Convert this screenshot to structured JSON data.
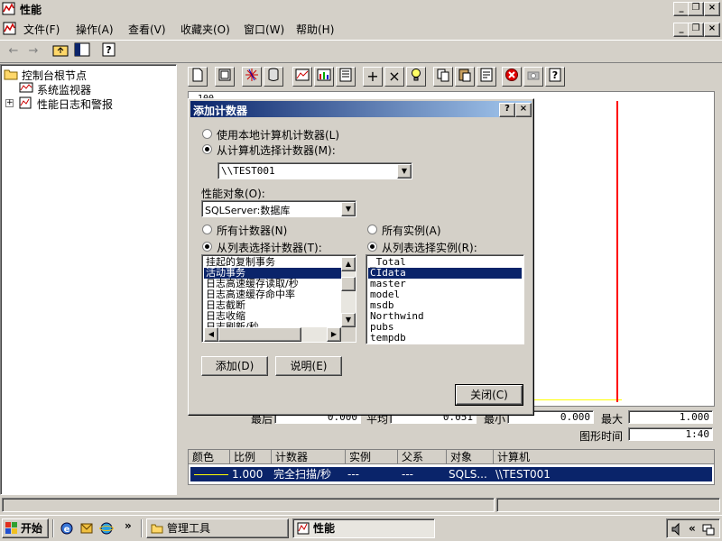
{
  "app": {
    "title": "性能"
  },
  "menu": [
    "文件(F)",
    "操作(A)",
    "查看(V)",
    "收藏夹(O)",
    "窗口(W)",
    "帮助(H)"
  ],
  "tree": {
    "root": "控制台根节点",
    "items": [
      "系统监视器",
      "性能日志和警报"
    ]
  },
  "stats": {
    "last_label": "最后",
    "last_value": "0.000",
    "avg_label": "平均",
    "avg_value": "0.051",
    "min_label": "最小",
    "min_value": "0.000",
    "max_label": "最大",
    "max_value": "1.000",
    "duration_label": "图形时间",
    "duration_value": "1:40"
  },
  "counter_table": {
    "headers": [
      "颜色",
      "比例",
      "计数器",
      "实例",
      "父系",
      "对象",
      "计算机"
    ],
    "row": {
      "scale": "1.000",
      "counter": "完全扫描/秒",
      "instance": "---",
      "parent": "---",
      "object": "SQLS...",
      "computer": "\\\\TEST001"
    }
  },
  "graph": {
    "y_top_label": "100"
  },
  "dialog": {
    "title": "添加计数器",
    "radio_local": "使用本地计算机计数器(L)",
    "radio_select": "从计算机选择计数器(M):",
    "computer_value": "\\\\TEST001",
    "object_label": "性能对象(O):",
    "object_value": "SQLServer:数据库",
    "all_counters": "所有计数器(N)",
    "select_counters": "从列表选择计数器(T):",
    "all_instances": "所有实例(A)",
    "select_instances": "从列表选择实例(R):",
    "counters": [
      "挂起的复制事务",
      "活动事务",
      "日志高速缓存读取/秒",
      "日志高速缓存命中率",
      "日志截断",
      "日志收缩",
      "日志刷新/秒"
    ],
    "instances": [
      "_Total",
      "CIdata",
      "master",
      "model",
      "msdb",
      "Northwind",
      "pubs",
      "tempdb"
    ],
    "add_button": "添加(D)",
    "explain_button": "说明(E)",
    "close_button": "关闭(C)",
    "help_title_button": "?",
    "close_title_button": "×"
  },
  "taskbar": {
    "start": "开始",
    "tasks": [
      "管理工具",
      "性能"
    ],
    "chevron": "»"
  },
  "colors": {
    "selection": "#0a246a",
    "graph_line": "#ff0000",
    "series": "#ffff00",
    "title_gradient_start": "#0a246a",
    "title_gradient_end": "#a6caf0"
  }
}
